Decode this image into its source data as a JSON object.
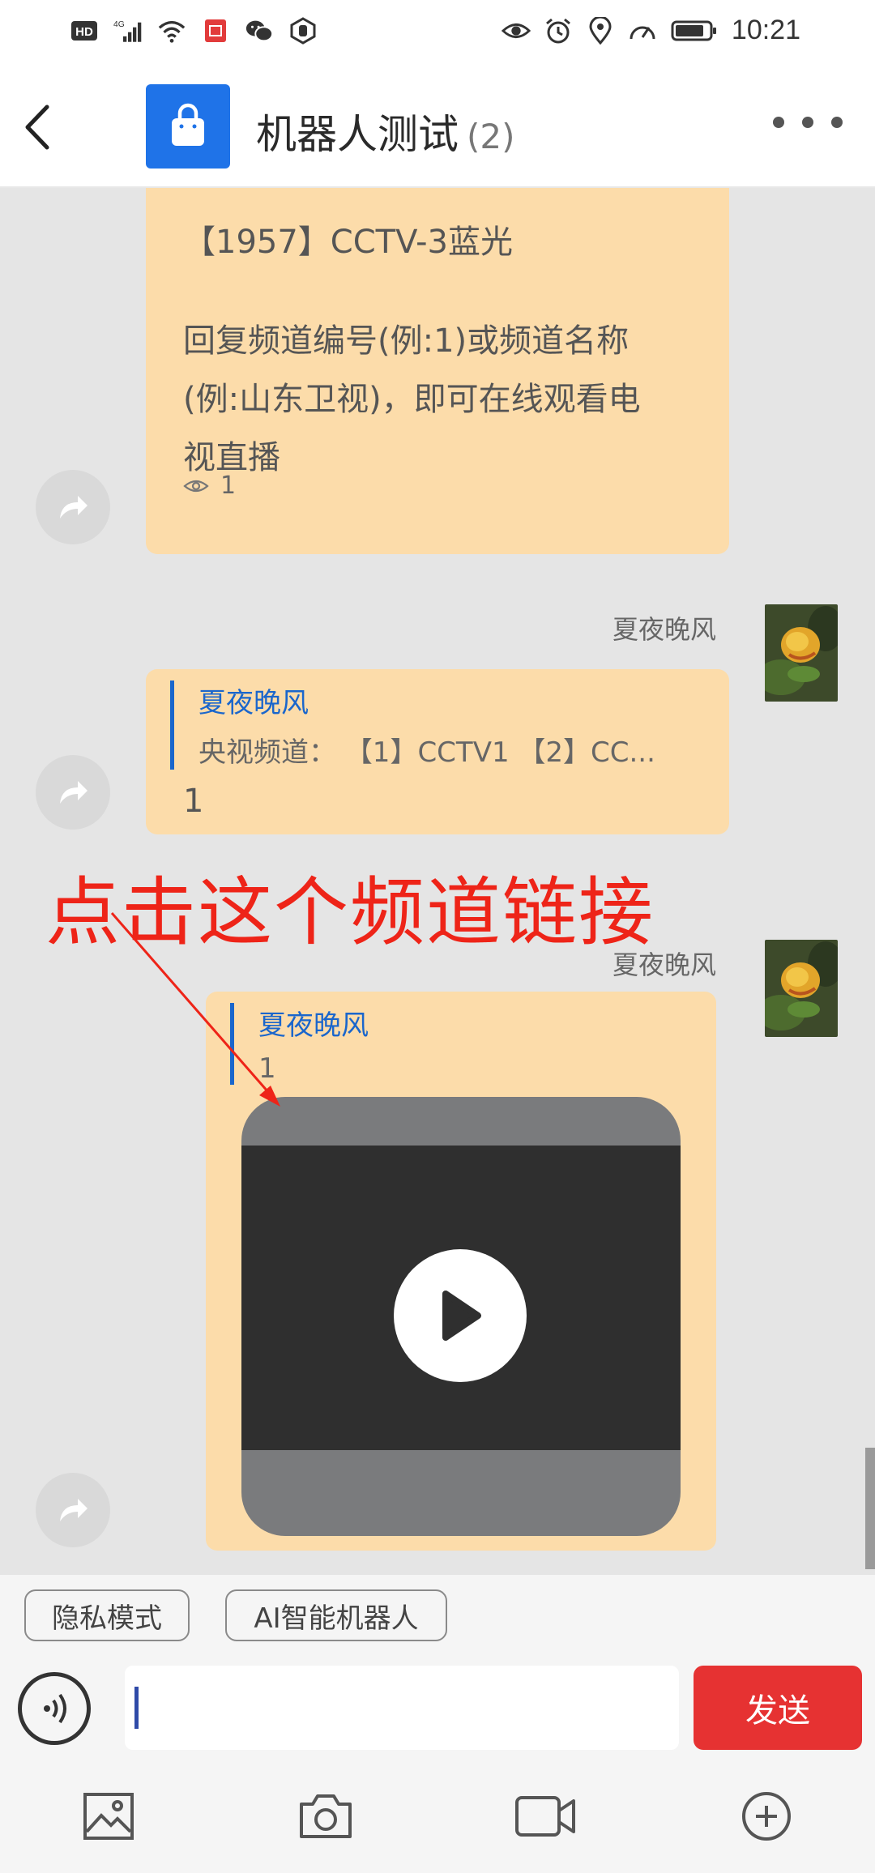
{
  "status_bar": {
    "left_icons": [
      "hd-icon",
      "signal-4g-icon",
      "wifi-icon",
      "app-notification-icon",
      "wechat-icon",
      "hand-icon"
    ],
    "right_icons": [
      "eye-icon",
      "alarm-icon",
      "location-icon",
      "speed-icon",
      "battery-icon"
    ],
    "hd_label": "HD",
    "net_label": "4G",
    "time": "10:21"
  },
  "header": {
    "title": "机器人测试",
    "member_count": "(2)",
    "logo_color": "#1f73e8"
  },
  "messages": {
    "bot_message": {
      "line1": "【1957】CCTV-3蓝光",
      "line2": "回复频道编号(例:1)或频道名称",
      "line3": "(例:山东卫视)，即可在线观看电",
      "line4": "视直播",
      "view_count": "1"
    },
    "reply1": {
      "sender": "夏夜晚风",
      "quote_name": "夏夜晚风",
      "quote_text": "央视频道：  【1】CCTV1 【2】CC...",
      "body": "1"
    },
    "reply2": {
      "sender": "夏夜晚风",
      "quote_name": "夏夜晚风",
      "quote_text": "1"
    },
    "annotation": "点击这个频道链接"
  },
  "chips": {
    "privacy": "隐私模式",
    "ai_robot": "AI智能机器人"
  },
  "input": {
    "placeholder": "",
    "send_label": "发送",
    "send_color": "#e63232"
  },
  "colors": {
    "bubble": "#fcdcaa",
    "quote_accent": "#1a66cc",
    "annotation": "#ee2418"
  }
}
